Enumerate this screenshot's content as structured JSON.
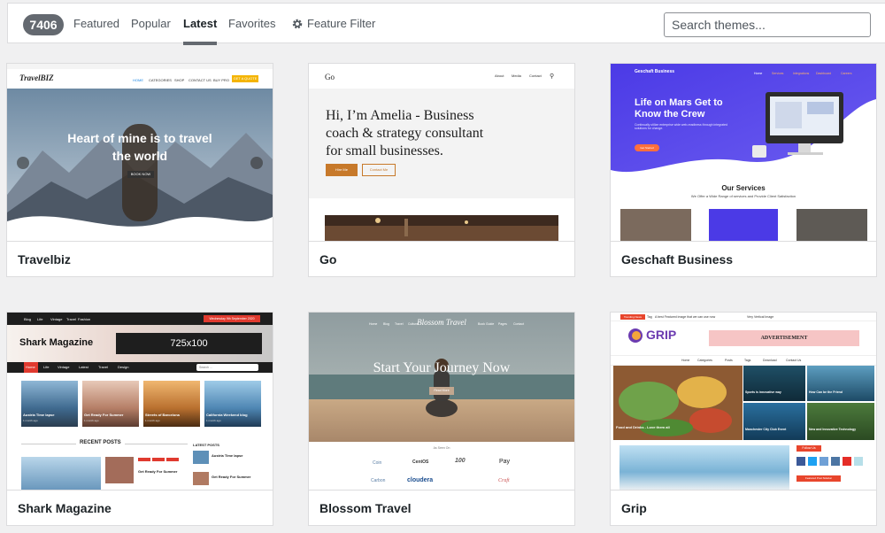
{
  "filter_bar": {
    "count": "7406",
    "tabs": [
      "Featured",
      "Popular",
      "Latest",
      "Favorites"
    ],
    "active_tab": "Latest",
    "feature_filter": "Feature Filter",
    "search_placeholder": "Search themes..."
  },
  "themes": [
    {
      "name": "Travelbiz",
      "preview": {
        "logo": "TravelBIZ",
        "nav": [
          "HOME",
          "CATEGORIES",
          "SHOP",
          "CONTACT US",
          "BUY PRO"
        ],
        "cta": "GET A QUOTE",
        "headline_1": "Heart of mine is to travel",
        "headline_2": "the world",
        "button": "BOOK NOW"
      }
    },
    {
      "name": "Go",
      "preview": {
        "logo": "Go",
        "nav": [
          "About",
          "Media",
          "Contact"
        ],
        "headline": "Hi, I’m Amelia - Business coach & strategy consultant for small businesses.",
        "button_1": "Hire Me",
        "button_2": "Contact Me"
      }
    },
    {
      "name": "Geschaft Business",
      "preview": {
        "logo": "Geschaft Business",
        "nav": [
          "Home",
          "Services",
          "Integrations",
          "Dashboard",
          "Careers"
        ],
        "headline": "Life on Mars Get to Know the Crew",
        "sub": "Continually utilize enterprise wide web-readiness through integrated solutions for change.",
        "button": "Get Started",
        "section_title": "Our Services",
        "section_sub": "We Offer a Wide Range of services and Provide Client Satisfaction"
      }
    },
    {
      "name": "Shark Magazine",
      "preview": {
        "top_nav": [
          "Blog",
          "Life",
          "Vintage",
          "Travel",
          "Fashion"
        ],
        "date": "Wednesday 9th September 2020",
        "logo": "Shark Magazine",
        "ad": "725x100",
        "menu": [
          "Home",
          "Life",
          "Vintage",
          "Latest",
          "Travel",
          "Design"
        ],
        "search": "Search ...",
        "posts": [
          "Austria Time lapse",
          "Get Ready For Summer",
          "Streets of Barcelona",
          "California Weekend blog"
        ],
        "post_meta": "1 month ago",
        "recent_title": "RECENT POSTS",
        "latest_title": "LATEST POSTS",
        "latest": [
          "Austria Time lapse",
          "Get Ready For Summer"
        ],
        "recent_post": "Get Ready For Summer"
      }
    },
    {
      "name": "Blossom Travel",
      "preview": {
        "logo": "Blossom Travel",
        "nav": [
          "Home",
          "Blog",
          "Travel",
          "Culture",
          "Book Guide",
          "Pages",
          "Contact"
        ],
        "headline": "Start Your Journey Now",
        "button": "Read More",
        "featured": "As Seen On",
        "brands": [
          "Coin",
          "CentOS",
          "100",
          "Pay",
          "Carbon",
          "cloudera",
          "Craft"
        ]
      }
    },
    {
      "name": "Grip",
      "preview": {
        "trending": "Trending News",
        "ticker": "Tag",
        "ticker_text": "A best Featured image that we can use now",
        "ticker_2": "Very Vertical Image",
        "logo": "GRIP",
        "ad": "ADVERTISEMENT",
        "nav": [
          "Home",
          "Categories",
          "Posts",
          "Tags",
          "Download",
          "Contact Us"
        ],
        "cards": [
          "Food and Drinks - Love them all",
          "Sports is innovative way",
          "How Can be the Friend",
          "Manchester City Club Event",
          "New and Innovative Technology"
        ],
        "follow": "Follow Us",
        "sidebar": "Featured Post Sidebar"
      }
    }
  ]
}
